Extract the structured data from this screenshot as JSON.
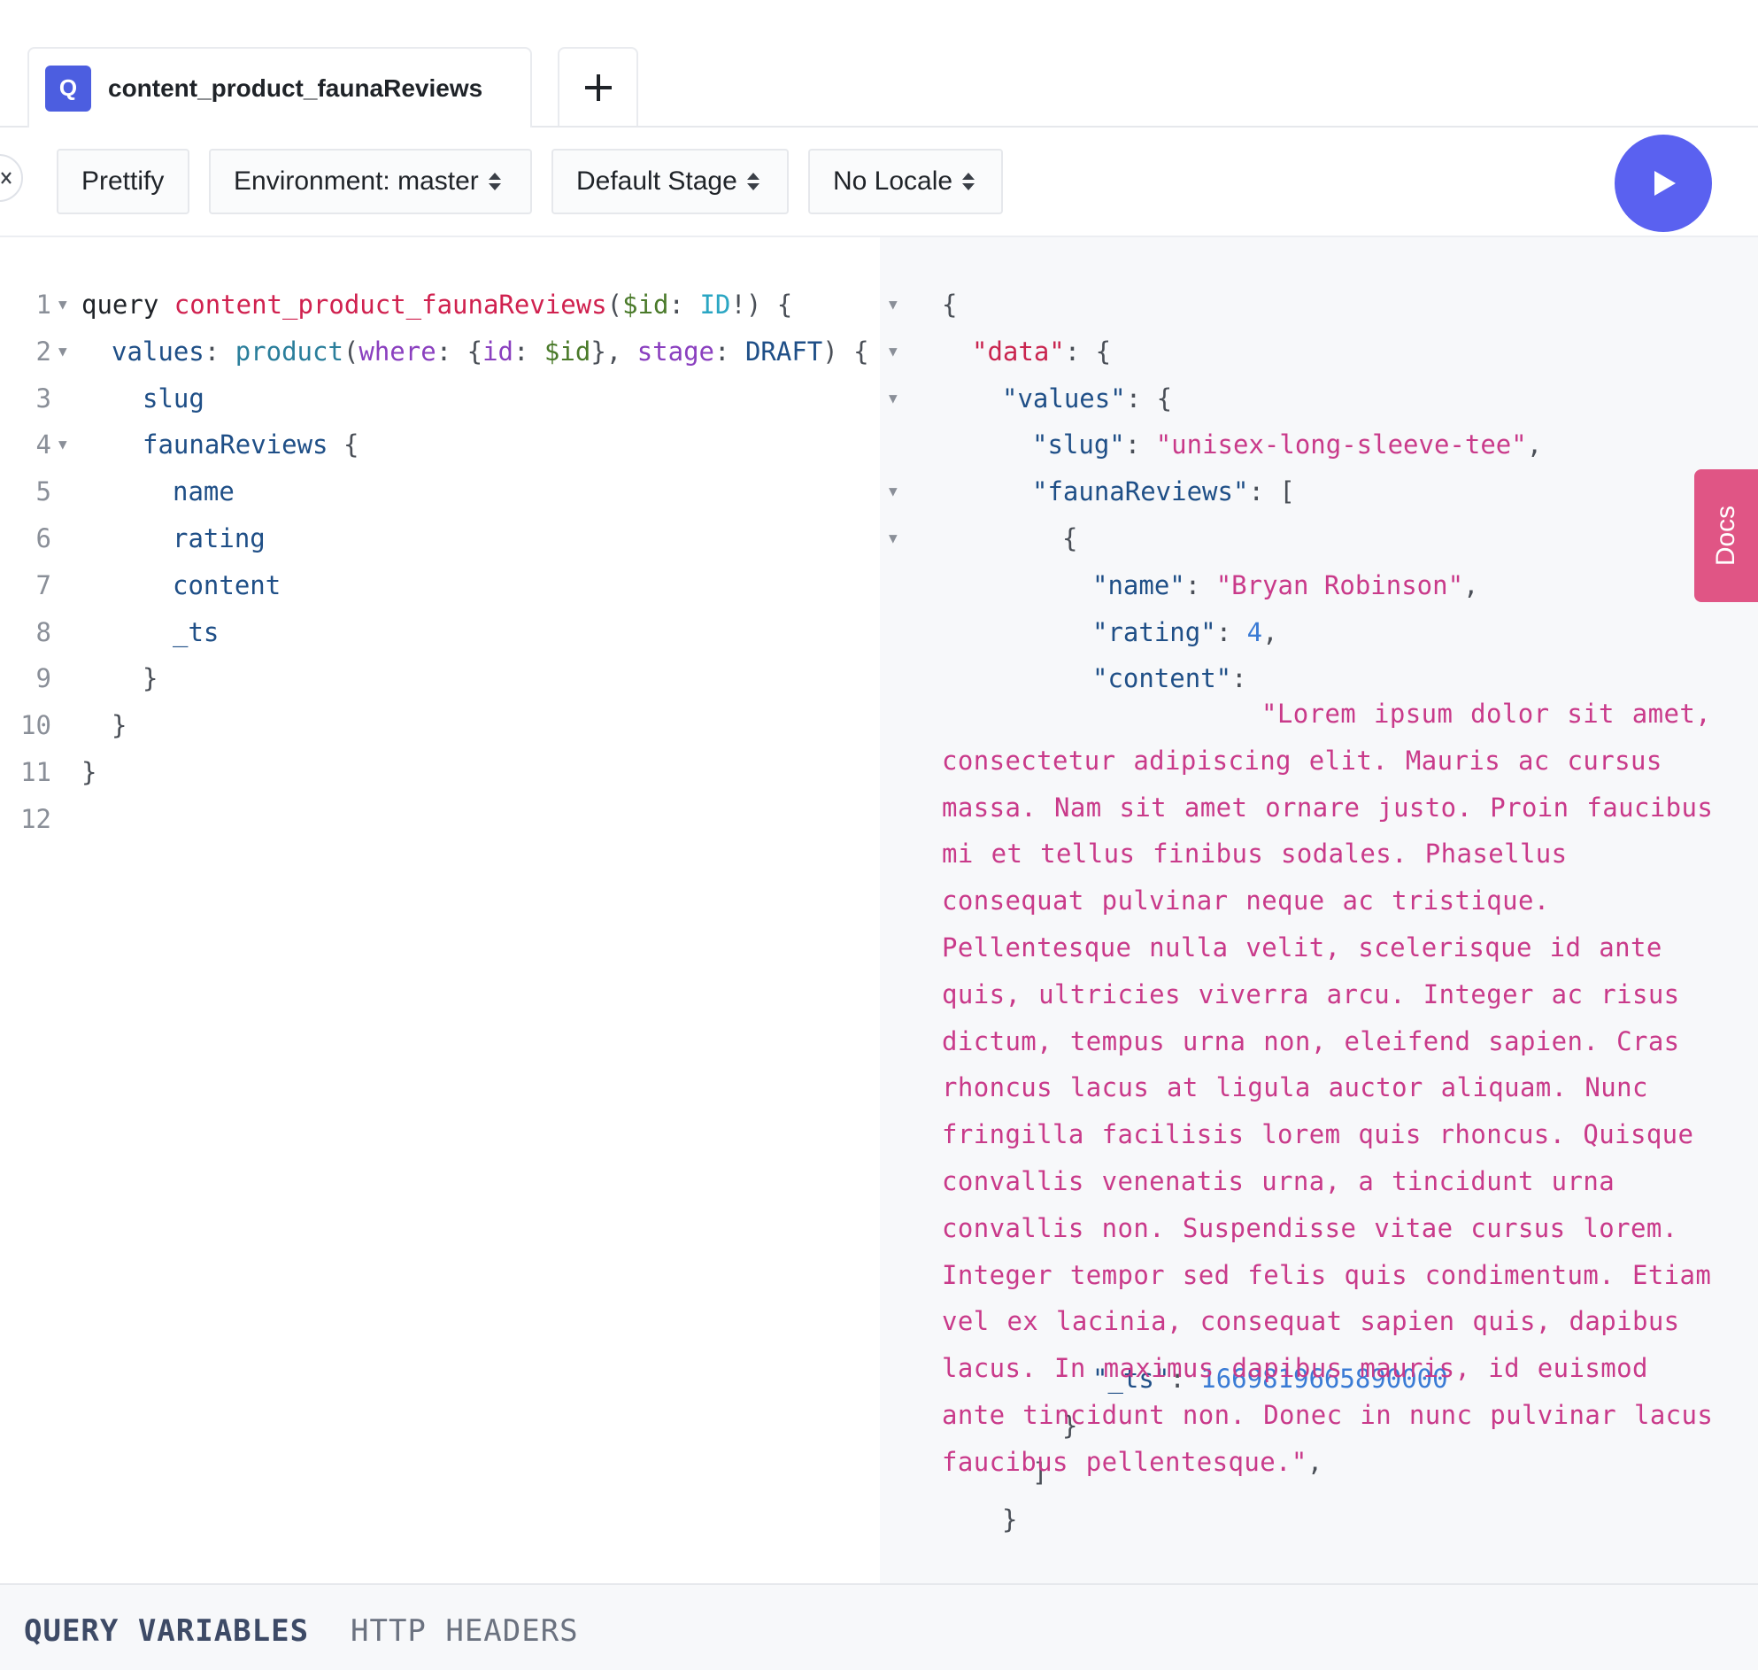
{
  "tab": {
    "badge": "Q",
    "title": "content_product_faunaReviews"
  },
  "toolbar": {
    "prettify": "Prettify",
    "environment": "Environment: master",
    "stage": "Default Stage",
    "locale": "No Locale"
  },
  "editor": {
    "line_numbers": [
      "1",
      "2",
      "3",
      "4",
      "5",
      "6",
      "7",
      "8",
      "9",
      "10",
      "11",
      "12"
    ],
    "l1": {
      "kw": "query",
      "name": "content_product_faunaReviews",
      "p1": "(",
      "var": "$id",
      "colon": ": ",
      "type": "ID",
      "rest": "!) {"
    },
    "l2": {
      "alias": "values",
      "colon": ": ",
      "fn": "product",
      "p1": "(",
      "arg1": "where",
      "c1": ": {",
      "id": "id",
      "c2": ": ",
      "v": "$id",
      "c3": "}, ",
      "arg2": "stage",
      "c4": ": ",
      "enum": "DRAFT",
      "close": ") {"
    },
    "l3": "slug",
    "l4": {
      "field": "faunaReviews",
      "brace": " {"
    },
    "l5": "name",
    "l6": "rating",
    "l7": "content",
    "l8": "_ts",
    "l9": "}",
    "l10": "}",
    "l11": "}"
  },
  "result": {
    "open": "{",
    "data_key": "\"data\"",
    "values_key": "\"values\"",
    "slug_key": "\"slug\"",
    "slug_val": "\"unisex-long-sleeve-tee\"",
    "fauna_key": "\"faunaReviews\"",
    "name_key": "\"name\"",
    "name_val": "\"Bryan Robinson\"",
    "rating_key": "\"rating\"",
    "rating_val": "4",
    "content_key": "\"content\"",
    "content_val": "\"Lorem ipsum dolor sit amet, consectetur adipiscing elit. Mauris ac cursus massa. Nam sit amet ornare justo. Proin faucibus mi et tellus finibus sodales. Phasellus consequat pulvinar neque ac tristique. Pellentesque nulla velit, scelerisque id ante quis, ultricies viverra arcu. Integer ac risus dictum, tempus urna non, eleifend sapien. Cras rhoncus lacus at ligula auctor aliquam. Nunc fringilla facilisis lorem quis rhoncus. Quisque convallis venenatis urna, a tincidunt urna convallis non. Suspendisse vitae cursus lorem. Integer tempor sed felis quis condimentum. Etiam vel ex lacinia, consequat sapien quis, dapibus lacus. In maximus dapibus mauris, id euismod ante tincidunt non. Donec in nunc pulvinar lacus faucibus pellentesque.\"",
    "ts_key": "\"_ts\"",
    "ts_val": "1669819665890000",
    "close_brace": "}",
    "close_bracket": "]"
  },
  "docs": {
    "label": "Docs"
  },
  "bottom": {
    "query_variables": "QUERY VARIABLES",
    "http_headers": "HTTP HEADERS"
  },
  "colors": {
    "accent": "#5a61f0",
    "docs": "#e05585",
    "badge": "#4c5ee0"
  },
  "icons": {
    "run": "play-icon",
    "add": "plus-icon",
    "collapse": "close-icon",
    "sort": "sort-icon",
    "fold": "fold-arrow-icon"
  }
}
